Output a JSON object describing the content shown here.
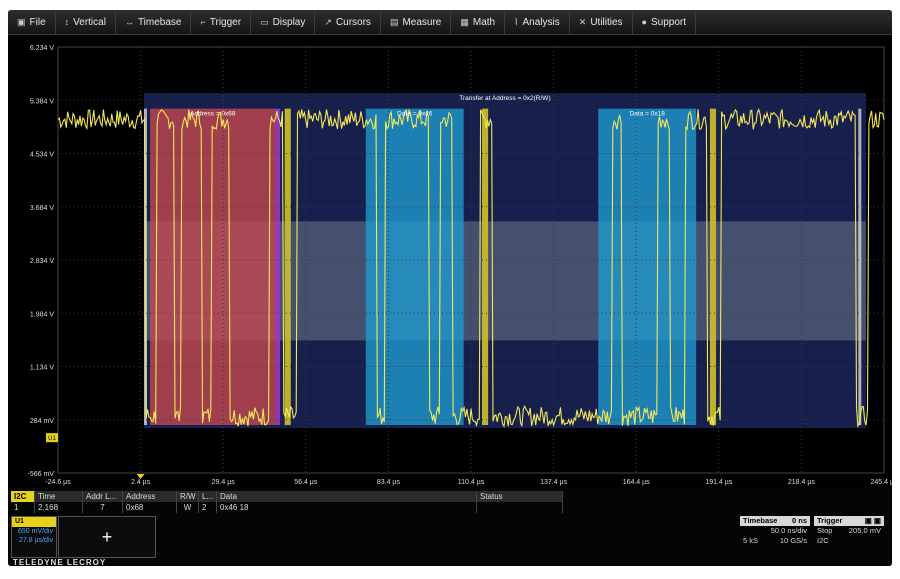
{
  "menu": [
    {
      "label": "File",
      "icon": "file-icon",
      "glyph": "▣"
    },
    {
      "label": "Vertical",
      "icon": "vertical-icon",
      "glyph": "↕"
    },
    {
      "label": "Timebase",
      "icon": "timebase-icon",
      "glyph": "↔"
    },
    {
      "label": "Trigger",
      "icon": "trigger-icon",
      "glyph": "⌐"
    },
    {
      "label": "Display",
      "icon": "display-icon",
      "glyph": "▭"
    },
    {
      "label": "Cursors",
      "icon": "cursors-icon",
      "glyph": "↗"
    },
    {
      "label": "Measure",
      "icon": "measure-icon",
      "glyph": "▤"
    },
    {
      "label": "Math",
      "icon": "math-icon",
      "glyph": "▦"
    },
    {
      "label": "Analysis",
      "icon": "analysis-icon",
      "glyph": "⌇"
    },
    {
      "label": "Utilities",
      "icon": "utilities-icon",
      "glyph": "✕"
    },
    {
      "label": "Support",
      "icon": "support-icon",
      "glyph": "●"
    }
  ],
  "scope": {
    "y_labels": [
      "6.234 V",
      "5.384 V",
      "4.534 V",
      "3.684 V",
      "2.834 V",
      "1.984 V",
      "1.134 V",
      "284 mV",
      "-566 mV"
    ],
    "x_labels": [
      "-24.6 µs",
      "2.4 µs",
      "29.4 µs",
      "56.4 µs",
      "83.4 µs",
      "110.4 µs",
      "137.4 µs",
      "164.4 µs",
      "191.4 µs",
      "218.4 µs",
      "245.4 µs"
    ],
    "marker_label": "U1",
    "decode_title": "Transfer at Address = 0x2(R/W)",
    "address_label": "Address = 0x68",
    "data1_label": "Data = 0x46",
    "data2_label": "Data = 0x18",
    "colors": {
      "trace": "#f2e75a",
      "frame": "#2a3a8a",
      "address": "#c9484f",
      "data": "#1e9bd0",
      "band": "#56607a",
      "ack": "#c9b92a"
    }
  },
  "table": {
    "protocol": "I2C",
    "headers": [
      "Time",
      "Addr L...",
      "Address",
      "R/W",
      "L...",
      "Data",
      "Status"
    ],
    "row": [
      "2.168",
      "7",
      "0x68",
      "W",
      "2",
      "0x46 18",
      ""
    ],
    "row_index": "1"
  },
  "channel": {
    "name": "U1",
    "v1": "650 mV/div",
    "v2": "27.8 µs/div"
  },
  "add_button": "+",
  "brand": "TELEDYNE LECROY",
  "timebase": {
    "title": "Timebase",
    "value": "0 ns",
    "rate": "50.0 ns/div",
    "samples": "5 kS",
    "sample_rate": "10 GS/s"
  },
  "trigger": {
    "title": "Trigger",
    "mode": "Stop",
    "level": "205.0 mV",
    "source": "I2C"
  }
}
